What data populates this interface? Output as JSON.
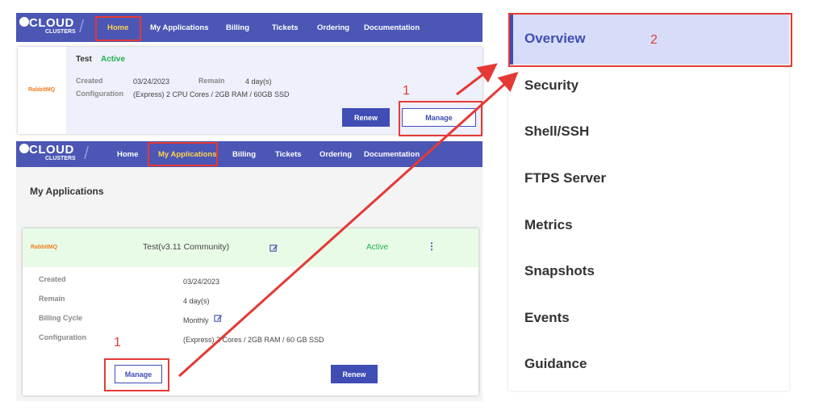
{
  "brand": {
    "name": "CLOUD",
    "sub": "CLUSTERS"
  },
  "nav": [
    "Home",
    "My Applications",
    "Billing",
    "Tickets",
    "Ordering",
    "Documentation"
  ],
  "home_card": {
    "name": "Test",
    "status": "Active",
    "created_label": "Created",
    "created_value": "03/24/2023",
    "remain_label": "Remain",
    "remain_value": "4 day(s)",
    "config_label": "Configuration",
    "config_value": "(Express) 2 CPU Cores / 2GB RAM / 60GB SSD",
    "renew": "Renew",
    "manage": "Manage",
    "logo_main": "RabbitMQ"
  },
  "apps": {
    "title": "My Applications",
    "row": {
      "logo": "RabbitMQ",
      "name": "Test(v3.11 Community)",
      "status": "Active"
    },
    "details": [
      {
        "label": "Created",
        "value": "03/24/2023"
      },
      {
        "label": "Remain",
        "value": "4 day(s)"
      },
      {
        "label": "Billing Cycle",
        "value": "Monthly"
      },
      {
        "label": "Configuration",
        "value": "(Express) 2 Cores / 2GB RAM / 60 GB SSD"
      }
    ],
    "manage": "Manage",
    "renew": "Renew"
  },
  "annotations": {
    "step1": "1",
    "step2": "2"
  },
  "menu": [
    "Overview",
    "Security",
    "Shell/SSH",
    "FTPS Server",
    "Metrics",
    "Snapshots",
    "Events",
    "Guidance"
  ],
  "colors": {
    "nav_bg": "#4b56b5",
    "active_nav": "#ffd54f",
    "accent": "#3f4db5",
    "annotation": "#e53935",
    "active_status": "#22b14c"
  }
}
